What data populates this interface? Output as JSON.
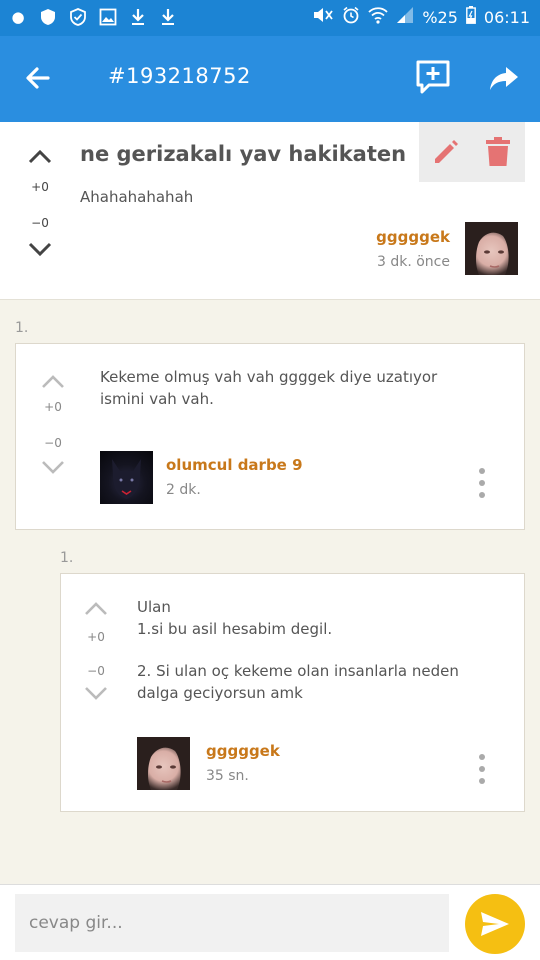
{
  "status_bar": {
    "left_icons": [
      "record-icon",
      "shield-icon",
      "shield-check-icon",
      "image-icon",
      "download-icon",
      "download-icon"
    ],
    "right_icons": [
      "mute-icon",
      "alarm-icon",
      "wifi-icon",
      "signal-icon"
    ],
    "battery": "%25",
    "time": "06:11"
  },
  "app_bar": {
    "title": "#193218752",
    "back_icon": "arrow-left-icon",
    "new_comment_icon": "comment-plus-icon",
    "share_icon": "share-icon"
  },
  "post": {
    "title": "ne gerizakalı yav hakikaten",
    "body": "Ahahahahahah",
    "upvotes": "+0",
    "downvotes": "−0",
    "author": "gggggek",
    "time": "3 dk. önce"
  },
  "comments": [
    {
      "index": "1.",
      "text": "Kekeme olmuş vah vah ggggek diye uzatıyor ismini vah vah.",
      "upvotes": "+0",
      "downvotes": "−0",
      "author": "olumcul darbe 9",
      "time": "2 dk."
    }
  ],
  "reply": {
    "index": "1.",
    "lines": [
      "Ulan",
      "1.si bu asil hesabim degil.",
      "2. Si ulan oç kekeme olan insanlarla neden",
      "dalga geciyorsun amk"
    ],
    "upvotes": "+0",
    "downvotes": "−0",
    "author": "gggggek",
    "time": "35 sn."
  },
  "input": {
    "placeholder": "cevap gir..."
  },
  "colors": {
    "primary": "#2a8ee0",
    "status": "#1c84d4",
    "accent": "#f5bf12",
    "author": "#c8781a",
    "delete": "#e57373"
  }
}
